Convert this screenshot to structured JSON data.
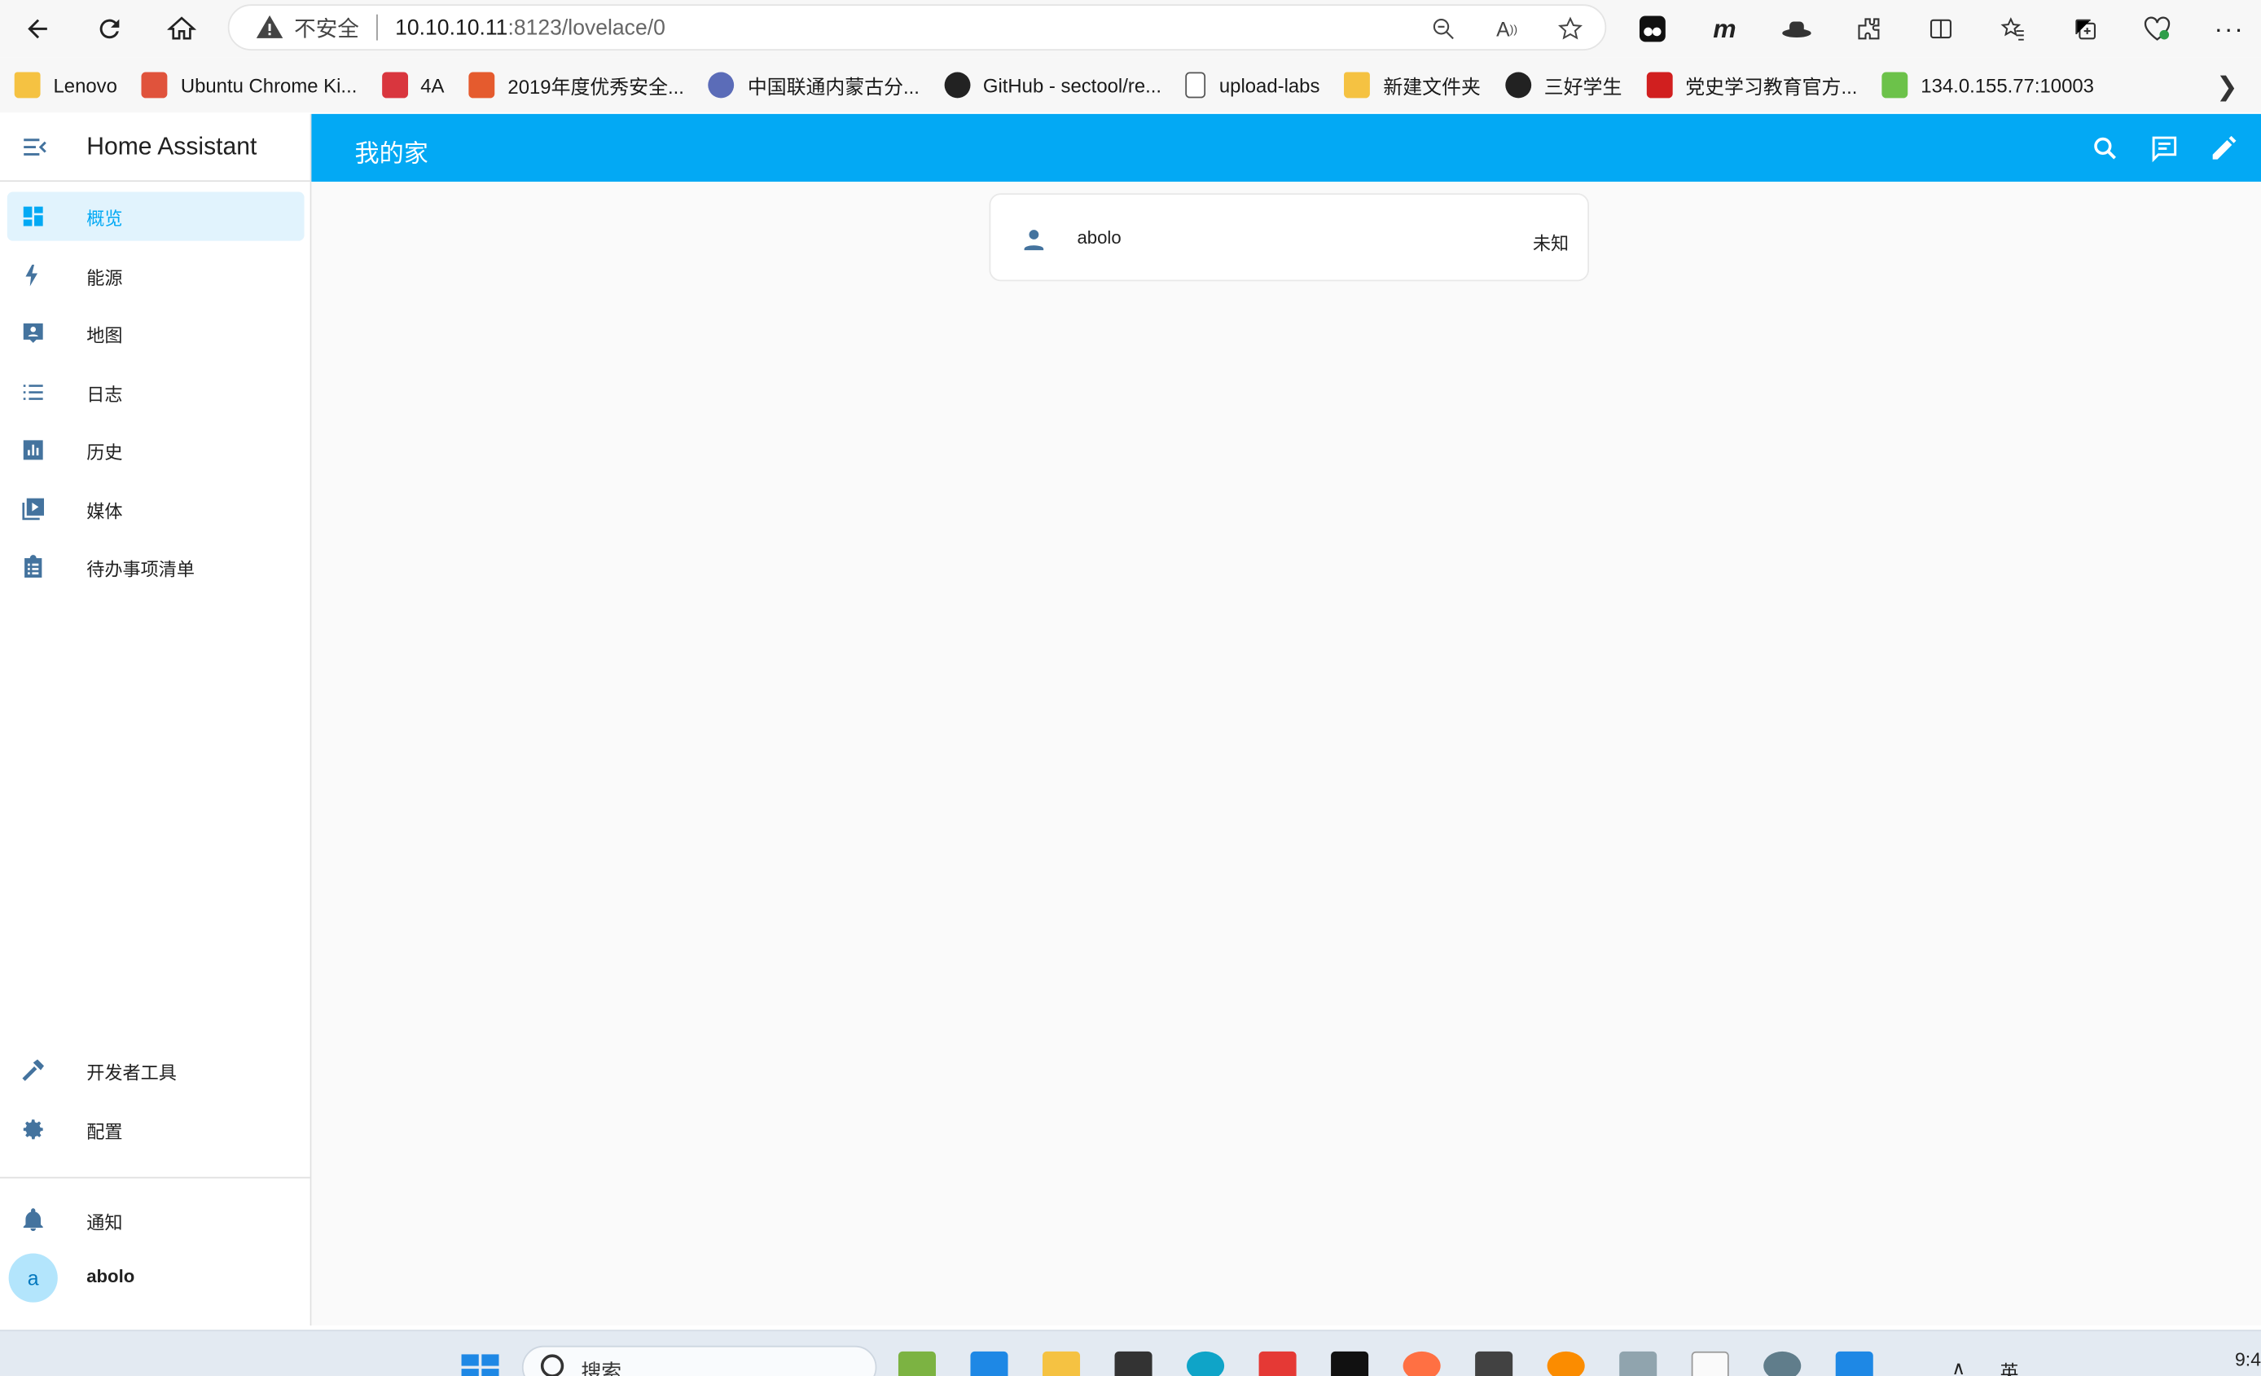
{
  "browser": {
    "security_label": "不安全",
    "url_host": "10.10.10.11",
    "url_path": ":8123/lovelace/0"
  },
  "bookmarks": [
    {
      "label": "Lenovo",
      "icon": "folder-icon",
      "color": "#f5c242"
    },
    {
      "label": "Ubuntu Chrome Ki...",
      "icon": "jian-icon",
      "color": "#e0533c"
    },
    {
      "label": "4A",
      "icon": "pdf-icon",
      "color": "#d9363e"
    },
    {
      "label": "2019年度优秀安全...",
      "icon": "c-icon",
      "color": "#e55b2e"
    },
    {
      "label": "中国联通内蒙古分...",
      "icon": "a-icon",
      "color": "#5b6cb8"
    },
    {
      "label": "GitHub - sectool/re...",
      "icon": "github-icon",
      "color": "#222222"
    },
    {
      "label": "upload-labs",
      "icon": "page-icon",
      "color": "#888888"
    },
    {
      "label": "新建文件夹",
      "icon": "folder-icon",
      "color": "#f5c242"
    },
    {
      "label": "三好学生",
      "icon": "github-icon",
      "color": "#222222"
    },
    {
      "label": "党史学习教育官方...",
      "icon": "party-icon",
      "color": "#d11f1f"
    },
    {
      "label": "134.0.155.77:10003",
      "icon": "leaf-icon",
      "color": "#6cc24a"
    }
  ],
  "sidebar": {
    "title": "Home Assistant",
    "items": [
      {
        "label": "概览",
        "icon": "dashboard-icon"
      },
      {
        "label": "能源",
        "icon": "lightning-icon"
      },
      {
        "label": "地图",
        "icon": "map-account-icon"
      },
      {
        "label": "日志",
        "icon": "list-icon"
      },
      {
        "label": "历史",
        "icon": "chart-bar-icon"
      },
      {
        "label": "媒体",
        "icon": "media-play-icon"
      },
      {
        "label": "待办事项清单",
        "icon": "clipboard-list-icon"
      }
    ],
    "bottom_items": [
      {
        "label": "开发者工具",
        "icon": "hammer-icon"
      },
      {
        "label": "配置",
        "icon": "gear-icon"
      }
    ],
    "notifications_label": "通知",
    "user": {
      "initial": "a",
      "name": "abolo"
    }
  },
  "header": {
    "title": "我的家"
  },
  "card": {
    "entity_name": "abolo",
    "state": "未知"
  },
  "taskbar": {
    "search_placeholder": "搜索",
    "ime": "英",
    "clock": "9:4"
  },
  "colors": {
    "primary": "#03a9f4",
    "active_bg": "#e1f3fd",
    "sidebar_icon": "#44739e"
  }
}
